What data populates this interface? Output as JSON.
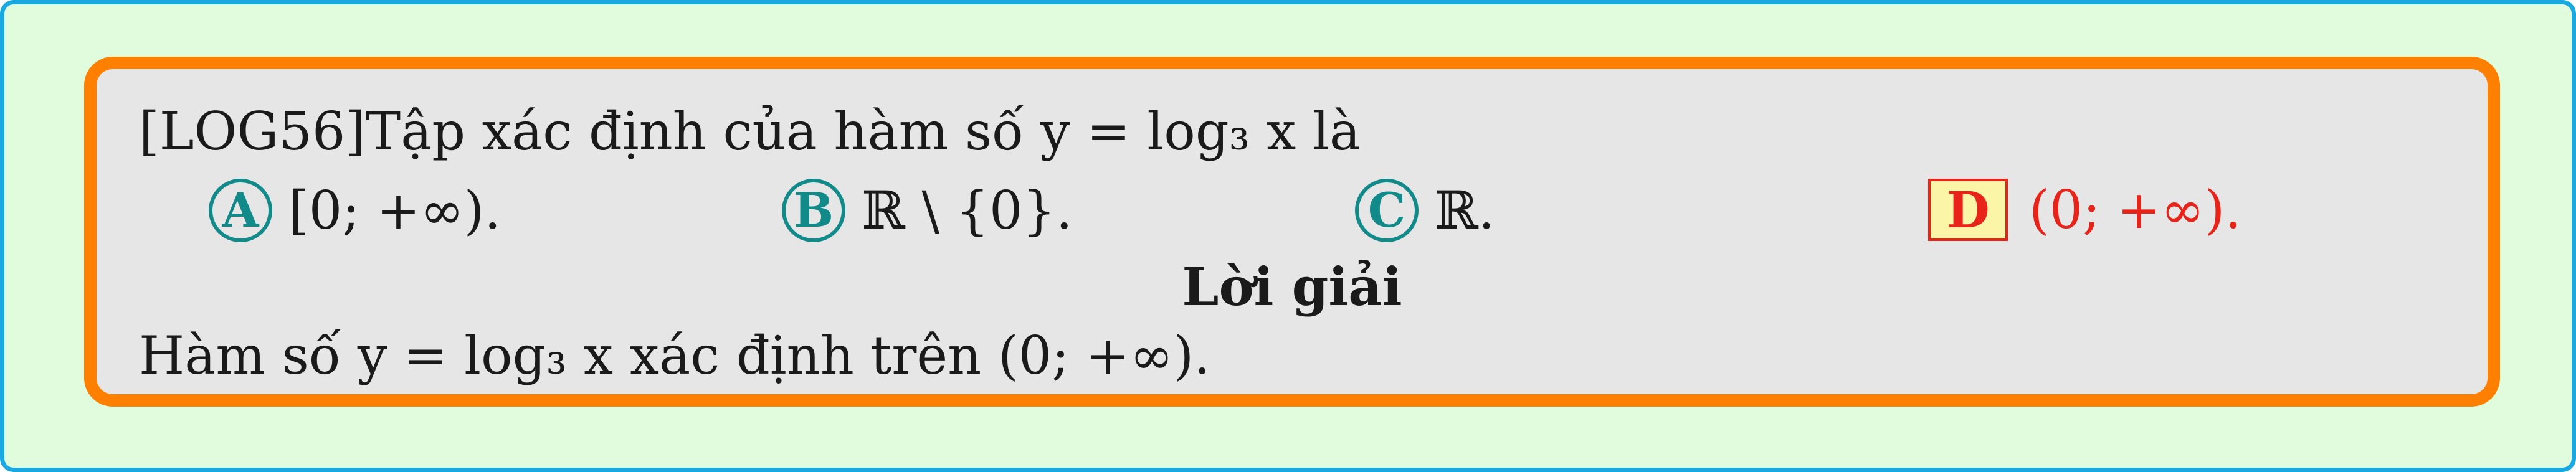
{
  "question": {
    "text": "[LOG56]Tập xác định của hàm số y = log₃ x là"
  },
  "choices": [
    {
      "label": "A",
      "text": "[0; +∞).",
      "correct": false
    },
    {
      "label": "B",
      "text": "ℝ \\ {0}.",
      "correct": false
    },
    {
      "label": "C",
      "text": "ℝ.",
      "correct": false
    },
    {
      "label": "D",
      "text": "(0; +∞).",
      "correct": true
    }
  ],
  "solution": {
    "title": "Lời giải",
    "text": "Hàm số y = log₃ x xác định trên (0; +∞)."
  },
  "colors": {
    "outer_background": "#e1fbdd",
    "outer_border": "#1aa8e0",
    "card_background": "#e6e6e6",
    "card_border": "#ff8000",
    "choice_badge": "#138a8a",
    "correct_answer": "#e8231a",
    "correct_badge_fill": "#fbf5a8"
  }
}
